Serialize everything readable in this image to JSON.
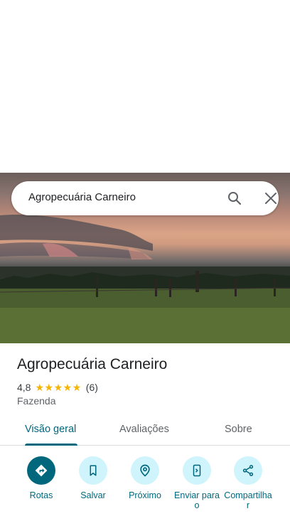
{
  "search": {
    "query": "Agropecuária Carneiro"
  },
  "place": {
    "name": "Agropecuária Carneiro",
    "rating": "4,8",
    "rating_stars": 5,
    "review_count": "(6)",
    "category": "Fazenda"
  },
  "tabs": [
    {
      "label": "Visão geral",
      "active": true
    },
    {
      "label": "Avaliações",
      "active": false
    },
    {
      "label": "Sobre",
      "active": false
    }
  ],
  "actions": [
    {
      "label": "Rotas",
      "icon": "directions-icon"
    },
    {
      "label": "Salvar",
      "icon": "bookmark-icon"
    },
    {
      "label": "Próximo",
      "icon": "nearby-icon"
    },
    {
      "label": "Enviar para o",
      "icon": "send-to-phone-icon"
    },
    {
      "label": "Compartilhar",
      "icon": "share-icon"
    }
  ],
  "colors": {
    "accent": "#00677d",
    "action_bg": "#cff4fc",
    "star": "#f4b400"
  }
}
